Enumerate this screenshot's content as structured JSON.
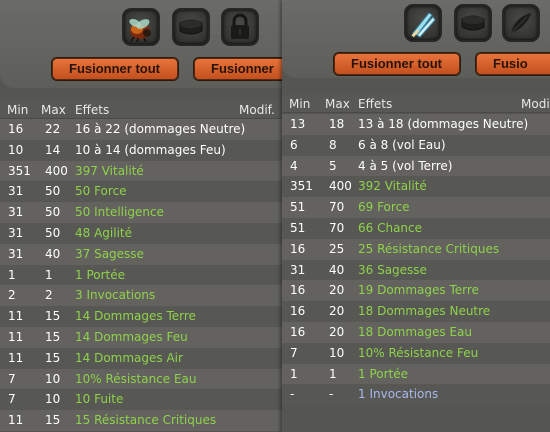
{
  "left": {
    "buttons": [
      "Fusionner tout",
      "Fusionner"
    ],
    "slots": [
      "beetle-pet-icon",
      "empty-slot-icon",
      "lock-icon"
    ],
    "headers": {
      "min": "Min",
      "max": "Max",
      "effects": "Effets",
      "modif": "Modif."
    },
    "rows": [
      {
        "min": "16",
        "max": "22",
        "effect": "16 à 22 (dommages Neutre)",
        "color": "#ffffff"
      },
      {
        "min": "10",
        "max": "14",
        "effect": "10 à 14 (dommages Feu)",
        "color": "#ffffff"
      },
      {
        "min": "351",
        "max": "400",
        "effect": "397 Vitalité",
        "color": "#8fd24a"
      },
      {
        "min": "31",
        "max": "50",
        "effect": "50 Force",
        "color": "#8fd24a"
      },
      {
        "min": "31",
        "max": "50",
        "effect": "50 Intelligence",
        "color": "#8fd24a"
      },
      {
        "min": "31",
        "max": "50",
        "effect": "48 Agilité",
        "color": "#8fd24a"
      },
      {
        "min": "31",
        "max": "40",
        "effect": "37 Sagesse",
        "color": "#8fd24a"
      },
      {
        "min": "1",
        "max": "1",
        "effect": "1 Portée",
        "color": "#8fd24a"
      },
      {
        "min": "2",
        "max": "2",
        "effect": "3 Invocations",
        "color": "#8fd24a"
      },
      {
        "min": "11",
        "max": "15",
        "effect": "14 Dommages Terre",
        "color": "#8fd24a"
      },
      {
        "min": "11",
        "max": "15",
        "effect": "14 Dommages Feu",
        "color": "#8fd24a"
      },
      {
        "min": "11",
        "max": "15",
        "effect": "14 Dommages Air",
        "color": "#8fd24a"
      },
      {
        "min": "7",
        "max": "10",
        "effect": "10% Résistance Eau",
        "color": "#8fd24a"
      },
      {
        "min": "7",
        "max": "10",
        "effect": "10 Fuite",
        "color": "#8fd24a"
      },
      {
        "min": "11",
        "max": "15",
        "effect": "15 Résistance Critiques",
        "color": "#8fd24a"
      }
    ]
  },
  "right": {
    "buttons": [
      "Fusionner tout",
      "Fusio"
    ],
    "slots": [
      "dagger-weapon-icon",
      "empty-slot-icon",
      "feather-icon"
    ],
    "headers": {
      "min": "Min",
      "max": "Max",
      "effects": "Effets",
      "modif": "Modif"
    },
    "rows": [
      {
        "min": "13",
        "max": "18",
        "effect": "13 à 18 (dommages Neutre)",
        "color": "#ffffff"
      },
      {
        "min": "6",
        "max": "8",
        "effect": "6 à 8 (vol Eau)",
        "color": "#ffffff"
      },
      {
        "min": "4",
        "max": "5",
        "effect": "4 à 5 (vol Terre)",
        "color": "#ffffff"
      },
      {
        "min": "351",
        "max": "400",
        "effect": "392 Vitalité",
        "color": "#8fd24a"
      },
      {
        "min": "51",
        "max": "70",
        "effect": "69 Force",
        "color": "#8fd24a"
      },
      {
        "min": "51",
        "max": "70",
        "effect": "66 Chance",
        "color": "#8fd24a"
      },
      {
        "min": "16",
        "max": "25",
        "effect": "25 Résistance Critiques",
        "color": "#8fd24a"
      },
      {
        "min": "31",
        "max": "40",
        "effect": "36 Sagesse",
        "color": "#8fd24a"
      },
      {
        "min": "16",
        "max": "20",
        "effect": "19 Dommages Terre",
        "color": "#8fd24a"
      },
      {
        "min": "16",
        "max": "20",
        "effect": "18 Dommages Neutre",
        "color": "#8fd24a"
      },
      {
        "min": "16",
        "max": "20",
        "effect": "18 Dommages Eau",
        "color": "#8fd24a"
      },
      {
        "min": "7",
        "max": "10",
        "effect": "10% Résistance Feu",
        "color": "#8fd24a"
      },
      {
        "min": "1",
        "max": "1",
        "effect": "1 Portée",
        "color": "#8fd24a"
      },
      {
        "min": "-",
        "max": "-",
        "effect": "1 Invocations",
        "color": "#a9b8ee"
      }
    ]
  }
}
